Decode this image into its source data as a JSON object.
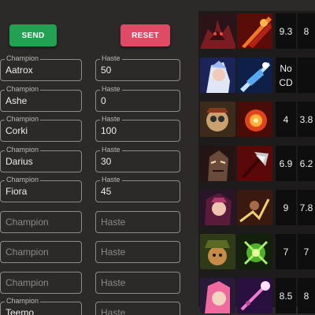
{
  "buttons": {
    "send": "SEND",
    "reset": "RESET"
  },
  "colors": {
    "send": "#22a152",
    "reset": "#df4a64",
    "background": "#2c2929"
  },
  "form": {
    "champion_legend": "Champion",
    "haste_legend": "Haste",
    "champion_placeholder": "Champion",
    "haste_placeholder": "Haste",
    "rows": [
      {
        "champion": "Aatrox",
        "haste": "50"
      },
      {
        "champion": "Ashe",
        "haste": "0"
      },
      {
        "champion": "Corki",
        "haste": "100"
      },
      {
        "champion": "Darius",
        "haste": "30"
      },
      {
        "champion": "Fiora",
        "haste": "45"
      },
      {
        "champion": "",
        "haste": ""
      },
      {
        "champion": "",
        "haste": ""
      },
      {
        "champion": "",
        "haste": ""
      },
      {
        "champion": "Teemo",
        "haste": ""
      }
    ]
  },
  "results": [
    {
      "champion_icon": "aatrox-portrait-icon",
      "ability_icon": "aatrox-ultimate-icon",
      "stat1": "9.3",
      "stat2": "8"
    },
    {
      "champion_icon": "ashe-portrait-icon",
      "ability_icon": "ashe-ultimate-icon",
      "stat1": "No CD",
      "stat2": ""
    },
    {
      "champion_icon": "corki-portrait-icon",
      "ability_icon": "corki-ultimate-icon",
      "stat1": "4",
      "stat2": "3.8"
    },
    {
      "champion_icon": "darius-portrait-icon",
      "ability_icon": "darius-ultimate-icon",
      "stat1": "6.9",
      "stat2": "6.2"
    },
    {
      "champion_icon": "fiora-portrait-icon",
      "ability_icon": "fiora-ultimate-icon",
      "stat1": "9",
      "stat2": "7.8"
    },
    {
      "champion_icon": "teemo-portrait-icon",
      "ability_icon": "teemo-ultimate-icon",
      "stat1": "7",
      "stat2": "7"
    },
    {
      "champion_icon": "champion-portrait-icon",
      "ability_icon": "ability-ultimate-icon",
      "stat1": "8.5",
      "stat2": "8"
    }
  ]
}
